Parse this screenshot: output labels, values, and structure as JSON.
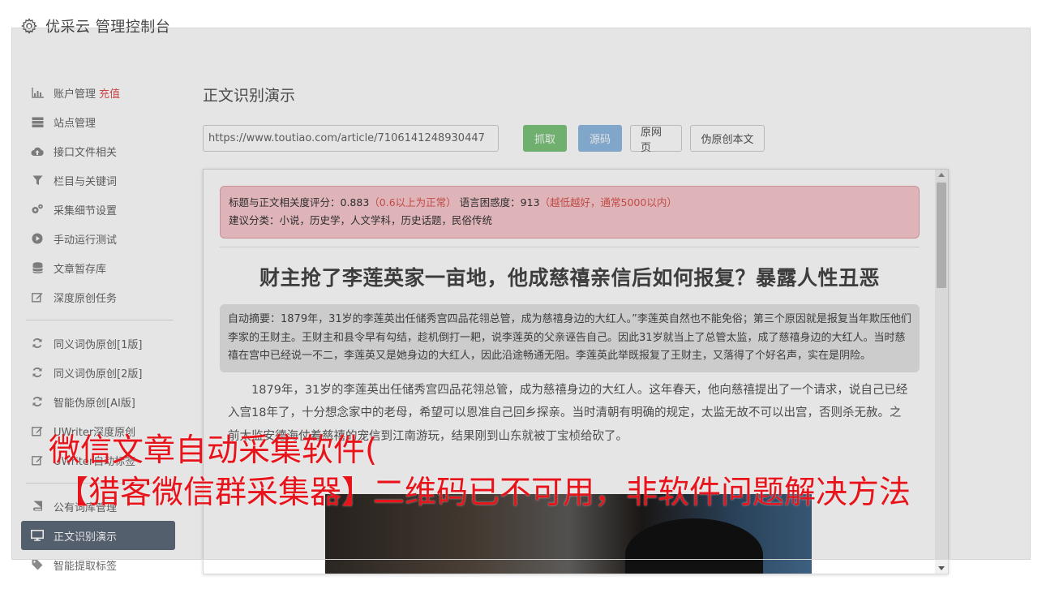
{
  "header": {
    "app_title": "优采云 管理控制台"
  },
  "sidebar": {
    "items": [
      {
        "label": "账户管理",
        "badge": "充值",
        "icon": "bar-chart-icon"
      },
      {
        "label": "站点管理",
        "icon": "server-icon"
      },
      {
        "label": "接口文件相关",
        "icon": "cloud-upload-icon"
      },
      {
        "label": "栏目与关键词",
        "icon": "filter-icon"
      },
      {
        "label": "采集细节设置",
        "icon": "cogs-icon"
      },
      {
        "label": "手动运行测试",
        "icon": "play-circle-icon"
      },
      {
        "label": "文章暂存库",
        "icon": "database-icon"
      },
      {
        "label": "深度原创任务",
        "icon": "edit-icon"
      },
      {
        "label": "同义词伪原创[1版]",
        "icon": "refresh-icon"
      },
      {
        "label": "同义词伪原创[2版]",
        "icon": "refresh-icon"
      },
      {
        "label": "智能伪原创[AI版]",
        "icon": "refresh-icon"
      },
      {
        "label": "UWriter深度原创",
        "icon": "edit-icon"
      },
      {
        "label": "UWriter自动标签",
        "icon": "edit-icon"
      },
      {
        "label": "公有词库管理",
        "icon": "book-icon"
      },
      {
        "label": "正文识别演示",
        "icon": "desktop-icon"
      },
      {
        "label": "智能提取标签",
        "icon": "tag-icon"
      }
    ]
  },
  "main": {
    "heading": "正文识别演示",
    "url_value": "https://www.toutiao.com/article/7106141248930447",
    "buttons": {
      "fetch": "抓取",
      "source": "源码",
      "original": "原网页",
      "pseudo": "伪原创本文"
    }
  },
  "article": {
    "score_prefix": "标题与正文相关度评分：0.883",
    "score_hint": "（0.6以上为正常）",
    "perplexity": " 语言困惑度：913",
    "perplexity_hint": "（越低越好，通常5000以内）",
    "category": "建议分类：小说，历史学，人文学科，历史话题，民俗传统",
    "title": "财主抢了李莲英家一亩地，他成慈禧亲信后如何报复？暴露人性丑恶",
    "summary": "自动摘要：1879年，31岁的李莲英出任储秀宫四品花翎总管，成为慈禧身边的大红人。”李莲英自然也不能免俗；第三个原因就是报复当年欺压他们李家的王财主。王财主和县令早有勾结，趁机倒打一耙，说李莲英的父亲诬告自己。因此31岁就当上了总管太监，成了慈禧身边的大红人。当时慈禧在宫中已经说一不二，李莲英又是她身边的大红人，因此沿途畅通无阻。李莲英此举既报复了王财主，又落得了个好名声，实在是阴险。",
    "body": "1879年，31岁的李莲英出任储秀宫四品花翎总管，成为慈禧身边的大红人。这年春天，他向慈禧提出了一个请求，说自己已经入宫18年了，十分想念家中的老母，希望可以恩准自己回乡探亲。当时清朝有明确的规定，太监无故不可以出宫，否则杀无赦。之前太监安德海仗着慈禧的宠信到江南游玩，结果刚到山东就被丁宝桢给砍了。"
  },
  "watermark": {
    "line1": "微信文章自动采集软件(",
    "line2": "【猎客微信群采集器】二维码已不可用，非软件问题解决方法"
  }
}
